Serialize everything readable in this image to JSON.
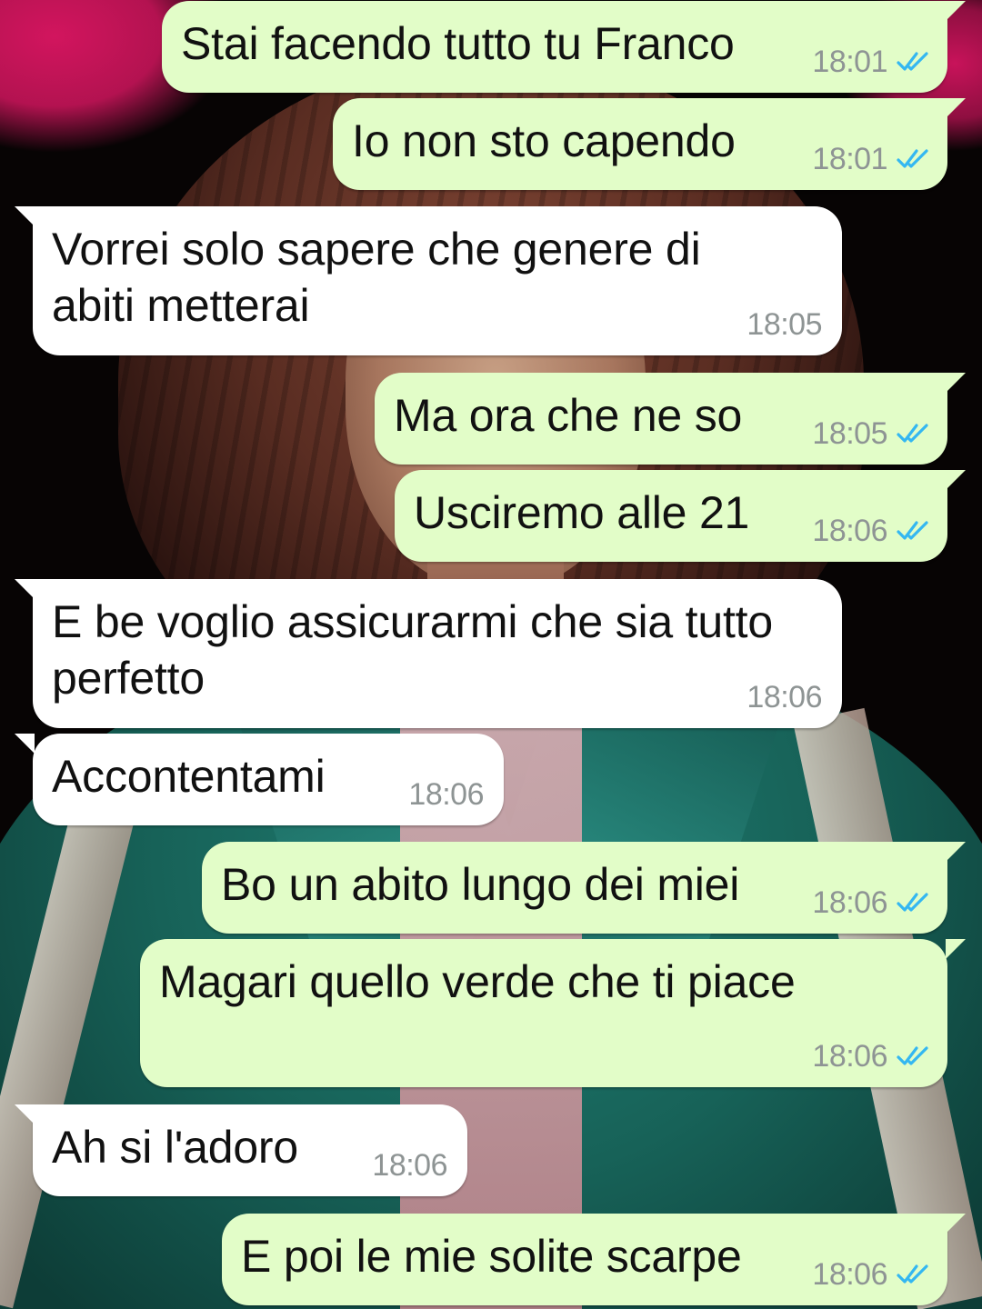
{
  "colors": {
    "outgoing_bubble": "#e2fdc8",
    "incoming_bubble": "#ffffff",
    "read_ticks": "#34b7f1",
    "timestamp": "#8e9494"
  },
  "messages": [
    {
      "direction": "out",
      "text": "Stai facendo tutto tu Franco",
      "time": "18:01",
      "status": "read-double-check-icon"
    },
    {
      "direction": "out",
      "text": "Io non sto capendo",
      "time": "18:01",
      "status": "read-double-check-icon"
    },
    {
      "direction": "in",
      "text": "Vorrei solo sapere che genere di\nabiti metterai",
      "time": "18:05"
    },
    {
      "direction": "out",
      "text": "Ma ora che ne so",
      "time": "18:05",
      "status": "read-double-check-icon"
    },
    {
      "direction": "out",
      "text": "Usciremo alle 21",
      "time": "18:06",
      "status": "read-double-check-icon"
    },
    {
      "direction": "in",
      "text": "E be voglio assicurarmi che sia tutto\nperfetto",
      "time": "18:06"
    },
    {
      "direction": "in",
      "text": "Accontentami",
      "time": "18:06"
    },
    {
      "direction": "out",
      "text": "Bo un abito lungo dei miei",
      "time": "18:06",
      "status": "read-double-check-icon"
    },
    {
      "direction": "out",
      "text": "Magari quello verde che ti piace",
      "time": "18:06",
      "status": "read-double-check-icon"
    },
    {
      "direction": "in",
      "text": "Ah si l'adoro",
      "time": "18:06"
    },
    {
      "direction": "out",
      "text": "E poi le mie solite scarpe",
      "time": "18:06",
      "status": "read-double-check-icon"
    }
  ]
}
